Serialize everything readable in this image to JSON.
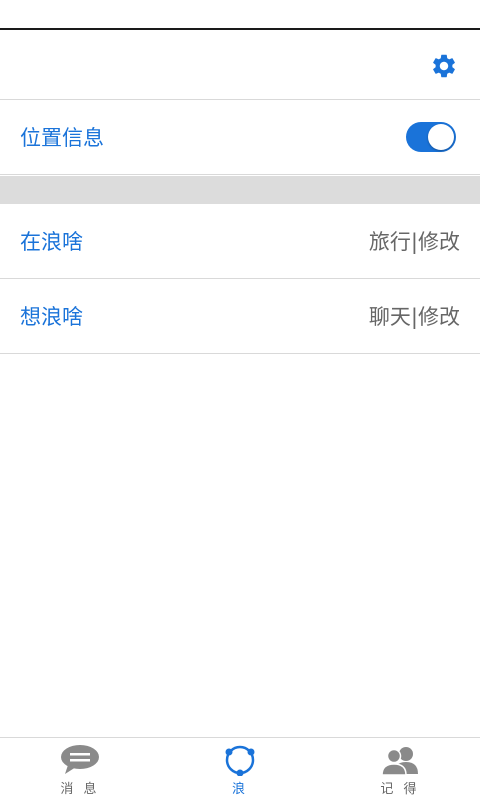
{
  "header": {
    "settings_icon": "gear-icon"
  },
  "location": {
    "label": "位置信息",
    "enabled": true
  },
  "rows": [
    {
      "label": "在浪啥",
      "value": "旅行|修改"
    },
    {
      "label": "想浪啥",
      "value": "聊天|修改"
    }
  ],
  "tabs": [
    {
      "label": "消 息",
      "icon": "chat-bubble-icon",
      "active": false
    },
    {
      "label": "浪",
      "icon": "wave-circle-icon",
      "active": true
    },
    {
      "label": "记 得",
      "icon": "contacts-icon",
      "active": false
    }
  ],
  "colors": {
    "accent": "#1a73d9",
    "muted": "#666666",
    "divider": "#d9d9d9",
    "gap": "#dcdcdc",
    "inactive_icon": "#8a8a8a"
  }
}
